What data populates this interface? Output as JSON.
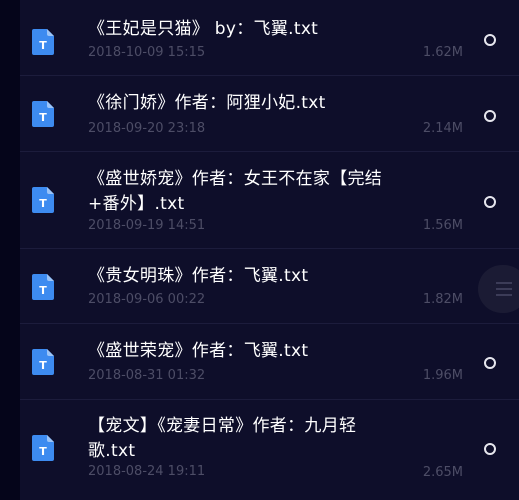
{
  "files": [
    {
      "name_lines": [
        "《王妃是只猫》 by：飞翼.txt"
      ],
      "date": "2018-10-09 15:15",
      "size": "1.62M",
      "icon": "txt-file-icon",
      "icon_letter": "T"
    },
    {
      "name_lines": [
        "《徐门娇》作者：阿狸小妃.txt"
      ],
      "date": "2018-09-20 23:18",
      "size": "2.14M",
      "icon": "txt-file-icon",
      "icon_letter": "T"
    },
    {
      "name_lines": [
        "《盛世娇宠》作者：女王不在家【完结",
        "+番外】.txt"
      ],
      "date": "2018-09-19 14:51",
      "size": "1.56M",
      "icon": "txt-file-icon",
      "icon_letter": "T"
    },
    {
      "name_lines": [
        "《贵女明珠》作者：飞翼.txt"
      ],
      "date": "2018-09-06 00:22",
      "size": "1.82M",
      "icon": "txt-file-icon",
      "icon_letter": "T"
    },
    {
      "name_lines": [
        "《盛世荣宠》作者：飞翼.txt"
      ],
      "date": "2018-08-31 01:32",
      "size": "1.96M",
      "icon": "txt-file-icon",
      "icon_letter": "T"
    },
    {
      "name_lines": [
        "【宠文】《宠妻日常》作者：九月轻",
        "歌.txt"
      ],
      "date": "2018-08-24 19:11",
      "size": "2.65M",
      "icon": "txt-file-icon",
      "icon_letter": "T"
    }
  ],
  "colors": {
    "icon_blue": "#3d8bf0",
    "icon_fold": "#9cc4f7",
    "title": "#ffffff",
    "meta": "#4d4d66",
    "row_background": "#0e0e2a",
    "page_background": "#05051a"
  }
}
